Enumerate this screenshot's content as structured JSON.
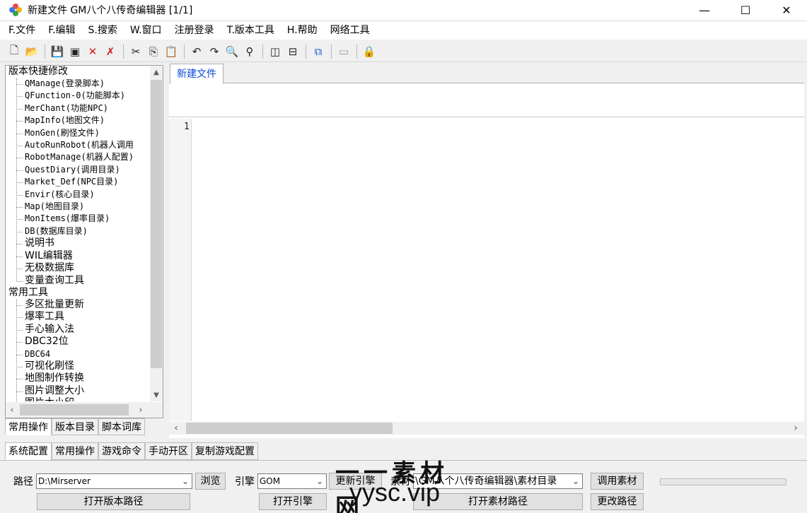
{
  "window": {
    "title": "新建文件 GM八个八传奇编辑器 [1/1]",
    "minimize_glyph": "—",
    "maximize_glyph": "☐",
    "close_glyph": "✕"
  },
  "menu": [
    "F.文件",
    "F.编辑",
    "S.搜索",
    "W.窗口",
    "注册登录",
    "T.版本工具",
    "H.帮助",
    "网络工具"
  ],
  "toolbar": {
    "icons": [
      {
        "name": "new-file-icon",
        "glyph": "🗋"
      },
      {
        "name": "open-folder-icon",
        "glyph": "📂"
      },
      {
        "sep": true
      },
      {
        "name": "save-icon",
        "glyph": "💾"
      },
      {
        "name": "save-all-icon",
        "glyph": "▣"
      },
      {
        "name": "close-icon",
        "glyph": "✕",
        "color": "#e11d1d"
      },
      {
        "name": "close-all-icon",
        "glyph": "✗",
        "color": "#c81e1e"
      },
      {
        "sep": true
      },
      {
        "name": "cut-icon",
        "glyph": "✂"
      },
      {
        "name": "copy-icon",
        "glyph": "⎘"
      },
      {
        "name": "paste-icon",
        "glyph": "📋"
      },
      {
        "sep": true
      },
      {
        "name": "undo-icon",
        "glyph": "↶"
      },
      {
        "name": "redo-icon",
        "glyph": "↷"
      },
      {
        "name": "find-icon",
        "glyph": "🔍"
      },
      {
        "name": "find-replace-icon",
        "glyph": "⚲"
      },
      {
        "sep": true
      },
      {
        "name": "split-vertical-icon",
        "glyph": "◫"
      },
      {
        "name": "split-horizontal-icon",
        "glyph": "⊟"
      },
      {
        "sep": true
      },
      {
        "name": "tree-view-icon",
        "glyph": "⧉",
        "color": "#1a5fd0"
      },
      {
        "sep": true
      },
      {
        "name": "console-icon",
        "glyph": "▭",
        "color": "#9a9a9a"
      },
      {
        "sep": true
      },
      {
        "name": "lock-icon",
        "glyph": "🔒",
        "color": "#c89a00"
      }
    ]
  },
  "tree": {
    "groups": [
      {
        "label": "版本快捷修改",
        "items": [
          {
            "label": "QManage(登录脚本)",
            "cjk": false
          },
          {
            "label": "QFunction-0(功能脚本)",
            "cjk": false
          },
          {
            "label": "MerChant(功能NPC)",
            "cjk": false
          },
          {
            "label": "MapInfo(地图文件)",
            "cjk": false
          },
          {
            "label": "MonGen(刷怪文件)",
            "cjk": false
          },
          {
            "label": "AutoRunRobot(机器人调用",
            "cjk": false
          },
          {
            "label": "RobotManage(机器人配置)",
            "cjk": false
          },
          {
            "label": "QuestDiary(调用目录)",
            "cjk": false
          },
          {
            "label": "Market_Def(NPC目录)",
            "cjk": false
          },
          {
            "label": "Envir(核心目录)",
            "cjk": false
          },
          {
            "label": "Map(地图目录)",
            "cjk": false
          },
          {
            "label": "MonItems(爆率目录)",
            "cjk": false
          },
          {
            "label": "DB(数据库目录)",
            "cjk": false
          },
          {
            "label": "说明书",
            "cjk": true
          },
          {
            "label": "WIL编辑器",
            "cjk": true
          },
          {
            "label": "无极数据库",
            "cjk": true
          },
          {
            "label": "变量查询工具",
            "cjk": true
          }
        ]
      },
      {
        "label": "常用工具",
        "items": [
          {
            "label": "多区批量更新",
            "cjk": true
          },
          {
            "label": "爆率工具",
            "cjk": true
          },
          {
            "label": "手心输入法",
            "cjk": true
          },
          {
            "label": "DBC32位",
            "cjk": true
          },
          {
            "label": "DBC64",
            "cjk": false
          },
          {
            "label": "可视化刷怪",
            "cjk": true
          },
          {
            "label": "地图制作转换",
            "cjk": true
          },
          {
            "label": "图片调整大小",
            "cjk": true
          },
          {
            "label": "图片大小印",
            "cjk": true
          }
        ]
      }
    ]
  },
  "left_tabs": [
    "常用操作",
    "版本目录",
    "脚本词库"
  ],
  "editor": {
    "doc_tab": "新建文件",
    "line_number": "1"
  },
  "bottom_tabs": [
    "系统配置",
    "常用操作",
    "游戏命令",
    "手动开区",
    "复制游戏配置"
  ],
  "bottom": {
    "path_label": "路径",
    "path_value": "D:\\Mirserver",
    "browse_button": "浏览",
    "engine_label": "引擎",
    "engine_value": "GOM",
    "update_engine_button": "更新引擎",
    "material_label": "素材",
    "material_value": "\\GM八个八传奇编辑器\\素材目录",
    "call_material_button": "调用素材",
    "open_version_path_button": "打开版本路径",
    "open_engine_button": "打开引擎",
    "open_material_path_button": "打开素材路径",
    "change_path_button": "更改路径"
  },
  "watermark": {
    "line1": "一一素材网",
    "line2": "yysc.vip"
  }
}
